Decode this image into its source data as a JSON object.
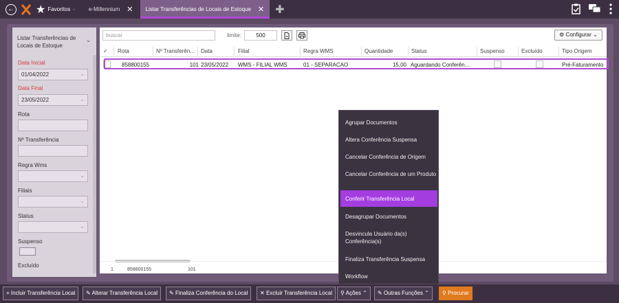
{
  "topbar": {
    "back_icon": "arrow-left-circle-icon",
    "favorites_label": "Favoritos",
    "tabs": [
      {
        "label": "e-Millennium"
      },
      {
        "label": "Listar Transferências de Locais de Estoque"
      }
    ],
    "right_icons": [
      "clipboard-check-icon",
      "chat-icon",
      "more-vertical-icon"
    ]
  },
  "sidebar": {
    "title": "Listar Transferências de Locais de Estoque",
    "fields": {
      "data_inicial_label": "Data Inicial",
      "data_inicial_value": "01/04/2022",
      "data_final_label": "Data Final",
      "data_final_value": "23/05/2022",
      "rota_label": "Rota",
      "n_transferencia_label": "Nº Transferência",
      "regra_wms_label": "Regra Wms",
      "filiais_label": "Filiais",
      "status_label": "Status",
      "suspenso_label": "Suspenso",
      "excluido_label": "Excluído"
    }
  },
  "toolbar": {
    "search_placeholder": "buscar",
    "limit_label": "limite:",
    "limit_value": "500",
    "configure_label": "Configurar"
  },
  "grid": {
    "columns": [
      "Rota",
      "Nº Transferên...",
      "Data",
      "Filial",
      "Regra WMS",
      "Quantidade",
      "Status",
      "Suspenso",
      "Excluído",
      "Tipo Origem"
    ],
    "rows": [
      {
        "rota": "858800155",
        "n_transferencia": "101",
        "data": "23/05/2022",
        "filial": "WMS - FILIAL WMS",
        "regra_wms": "01 - SEPARACAO",
        "quantidade": "15,00",
        "status": "Aguardando Conferên...",
        "tipo_origem": "Pré-Faturamento"
      }
    ],
    "footer": {
      "count": "1",
      "rota": "858800155",
      "n_transferencia": "101"
    }
  },
  "menu": {
    "items": [
      "Agrupar Documentos",
      "Altera Conferência Suspensa",
      "Cancelar Conferência de Origem",
      "Cancelar Conferência de um Produto",
      "Conferir Transferência Local",
      "Desagrupar Documentos",
      "Desvincula Usuário da(s) Conferência(s)",
      "Finaliza Transferência Suspensa",
      "Workflow"
    ],
    "active_index": 4
  },
  "bottombar": {
    "buttons": [
      "Incluir Transferência Local",
      "Alterar Transferência Local",
      "Finaliza Conferência do Local",
      "Excluir Transferência Local",
      "Ações",
      "Outras Funções",
      "Procurar"
    ]
  },
  "colors": {
    "accent": "#b04ad6",
    "menu_active": "#a43de0",
    "search_button": "#e07a1f",
    "required_label": "#d23c3c"
  }
}
